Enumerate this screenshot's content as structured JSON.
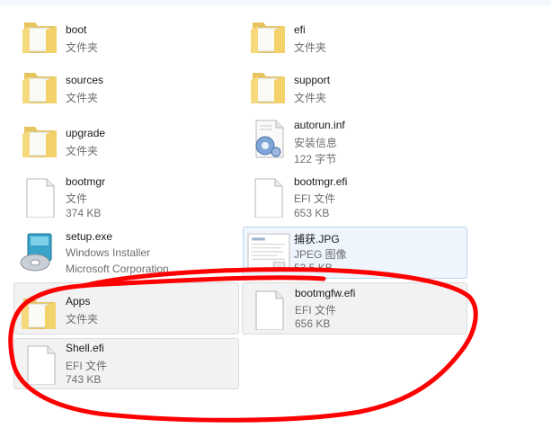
{
  "items": [
    {
      "name": "boot",
      "line1": "文件夹",
      "line2": "",
      "icon": "folder-icon"
    },
    {
      "name": "efi",
      "line1": "文件夹",
      "line2": "",
      "icon": "folder-icon"
    },
    {
      "name": "sources",
      "line1": "文件夹",
      "line2": "",
      "icon": "folder-icon"
    },
    {
      "name": "support",
      "line1": "文件夹",
      "line2": "",
      "icon": "folder-icon"
    },
    {
      "name": "upgrade",
      "line1": "文件夹",
      "line2": "",
      "icon": "folder-icon"
    },
    {
      "name": "autorun.inf",
      "line1": "安装信息",
      "line2": "122 字节",
      "icon": "settings-file-icon"
    },
    {
      "name": "bootmgr",
      "line1": "文件",
      "line2": "374 KB",
      "icon": "file-icon"
    },
    {
      "name": "bootmgr.efi",
      "line1": "EFI 文件",
      "line2": "653 KB",
      "icon": "file-icon"
    },
    {
      "name": "setup.exe",
      "line1": "Windows Installer",
      "line2": "Microsoft Corporation",
      "icon": "installer-icon"
    },
    {
      "name": "捕获.JPG",
      "line1": "JPEG 图像",
      "line2": "53.5 KB",
      "icon": "image-thumbnail-icon"
    },
    {
      "name": "Apps",
      "line1": "文件夹",
      "line2": "",
      "icon": "folder-icon"
    },
    {
      "name": "bootmgfw.efi",
      "line1": "EFI 文件",
      "line2": "656 KB",
      "icon": "file-icon"
    },
    {
      "name": "Shell.efi",
      "line1": "EFI 文件",
      "line2": "743 KB",
      "icon": "file-icon"
    }
  ],
  "colors": {
    "annotation": "#ff0000",
    "selection": "#eef5fd",
    "folder": "#f5d77a"
  }
}
